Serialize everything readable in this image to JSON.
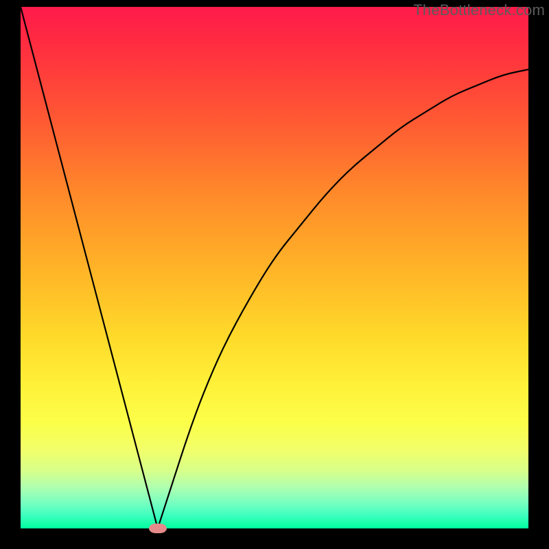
{
  "watermark": "TheBottleneck.com",
  "colors": {
    "frame": "#000000",
    "curve": "#000000",
    "marker": "#e58a8a"
  },
  "chart_data": {
    "type": "line",
    "title": "",
    "xlabel": "",
    "ylabel": "",
    "xlim": [
      0,
      100
    ],
    "ylim": [
      0,
      100
    ],
    "grid": false,
    "legend": false,
    "notes": "V-shaped bottleneck curve on rainbow gradient. x is a normalized component score; y is bottleneck percentage. Minimum near x≈27 (marked with pink pill).",
    "series": [
      {
        "name": "bottleneck-curve",
        "x": [
          0,
          3,
          6,
          9,
          12,
          15,
          18,
          21,
          24,
          27,
          30,
          33,
          36,
          40,
          45,
          50,
          55,
          60,
          65,
          70,
          75,
          80,
          85,
          90,
          95,
          100
        ],
        "values": [
          100,
          89,
          78,
          67,
          56,
          45,
          34,
          23,
          12,
          0,
          9,
          18,
          26,
          35,
          44,
          52,
          58,
          64,
          69,
          73,
          77,
          80,
          83,
          85,
          87,
          88
        ]
      }
    ],
    "marker": {
      "x": 27,
      "y": 0
    }
  }
}
